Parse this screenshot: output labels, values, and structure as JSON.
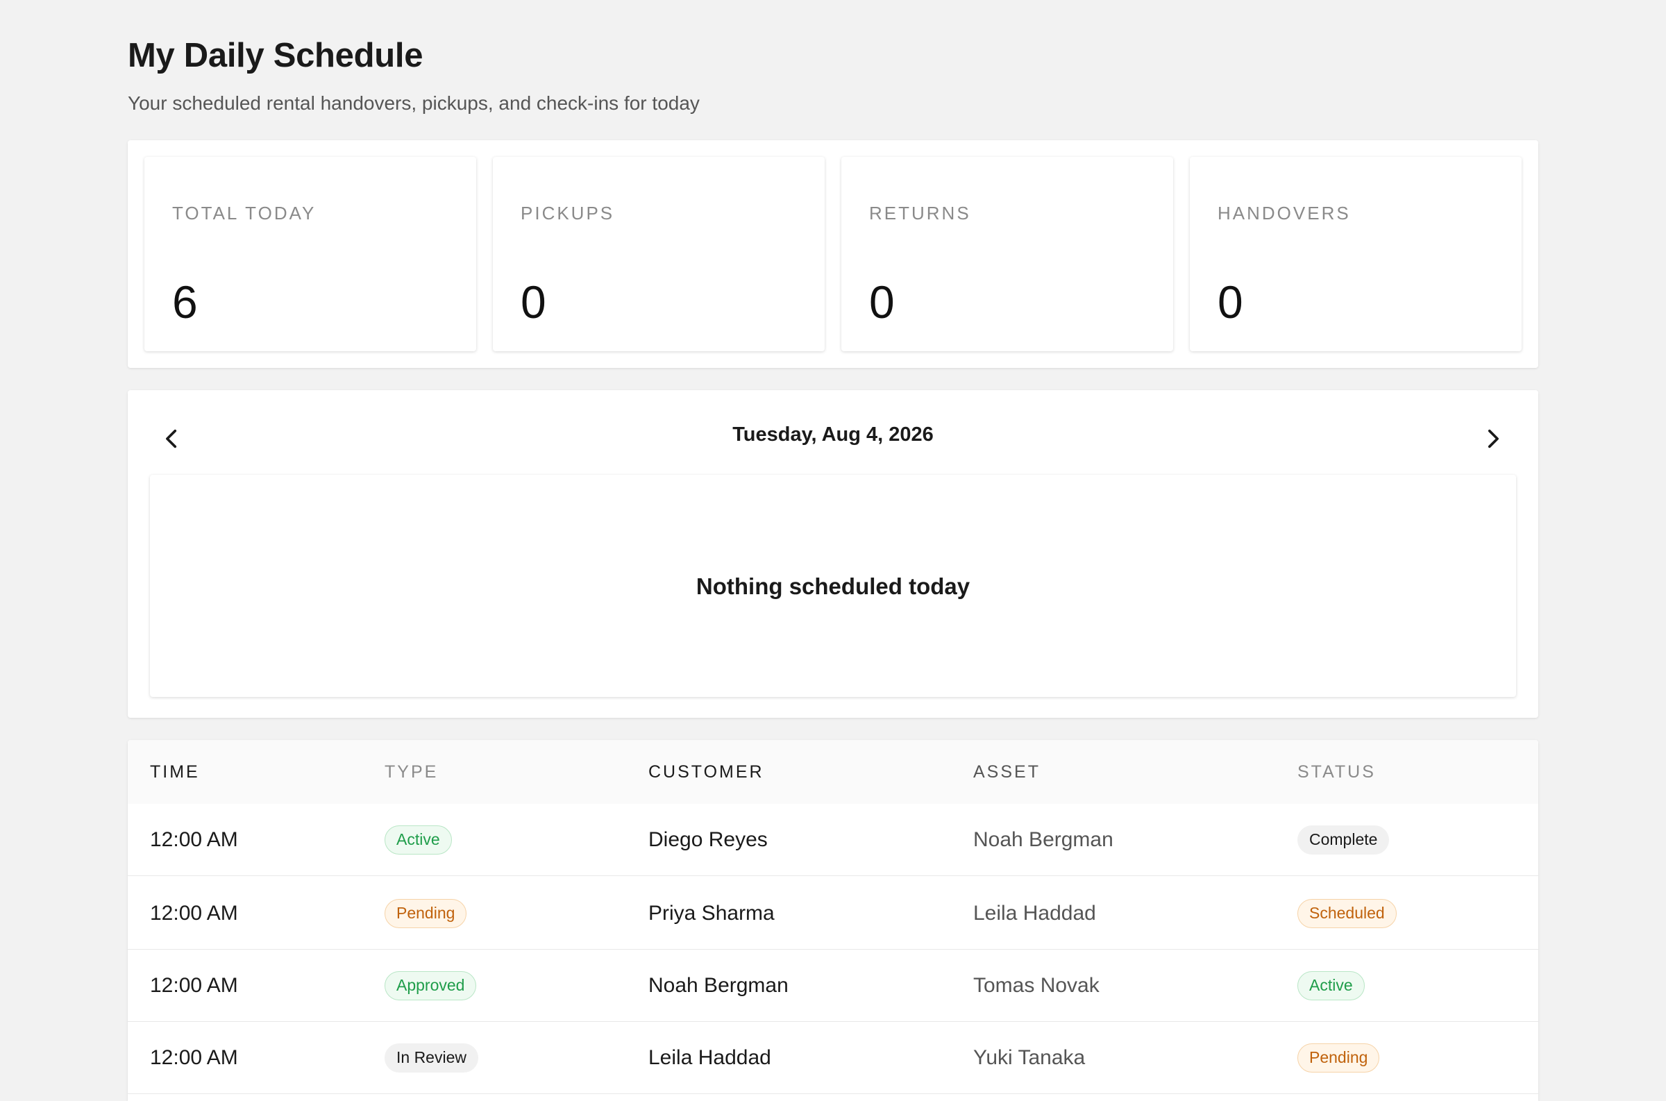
{
  "header": {
    "title": "My Daily Schedule",
    "subtitle": "Your scheduled rental handovers, pickups, and check-ins for today"
  },
  "stats": [
    {
      "label": "TOTAL TODAY",
      "value": "6"
    },
    {
      "label": "PICKUPS",
      "value": "0"
    },
    {
      "label": "RETURNS",
      "value": "0"
    },
    {
      "label": "HANDOVERS",
      "value": "0"
    }
  ],
  "date_nav": {
    "prev_icon": "chevron-left-icon",
    "next_icon": "chevron-right-icon",
    "date": "Tuesday, Aug 4, 2026",
    "empty_message": "Nothing scheduled today"
  },
  "table": {
    "columns": [
      "TIME",
      "TYPE",
      "CUSTOMER",
      "ASSET",
      "STATUS"
    ],
    "rows": [
      {
        "time": "12:00 AM",
        "type": "Active",
        "type_style": "green",
        "customer": "Diego Reyes",
        "asset": "Noah Bergman",
        "status": "Complete",
        "status_style": "gray"
      },
      {
        "time": "12:00 AM",
        "type": "Pending",
        "type_style": "orange",
        "customer": "Priya Sharma",
        "asset": "Leila Haddad",
        "status": "Scheduled",
        "status_style": "orange"
      },
      {
        "time": "12:00 AM",
        "type": "Approved",
        "type_style": "green",
        "customer": "Noah Bergman",
        "asset": "Tomas Novak",
        "status": "Active",
        "status_style": "green"
      },
      {
        "time": "12:00 AM",
        "type": "In Review",
        "type_style": "gray",
        "customer": "Leila Haddad",
        "asset": "Yuki Tanaka",
        "status": "Pending",
        "status_style": "orange"
      }
    ]
  },
  "colors": {
    "background": "#f2f2f2",
    "green_badge_text": "#1f9d4a",
    "orange_badge_text": "#c0620c",
    "gray_badge_bg": "#f1f1f1"
  }
}
